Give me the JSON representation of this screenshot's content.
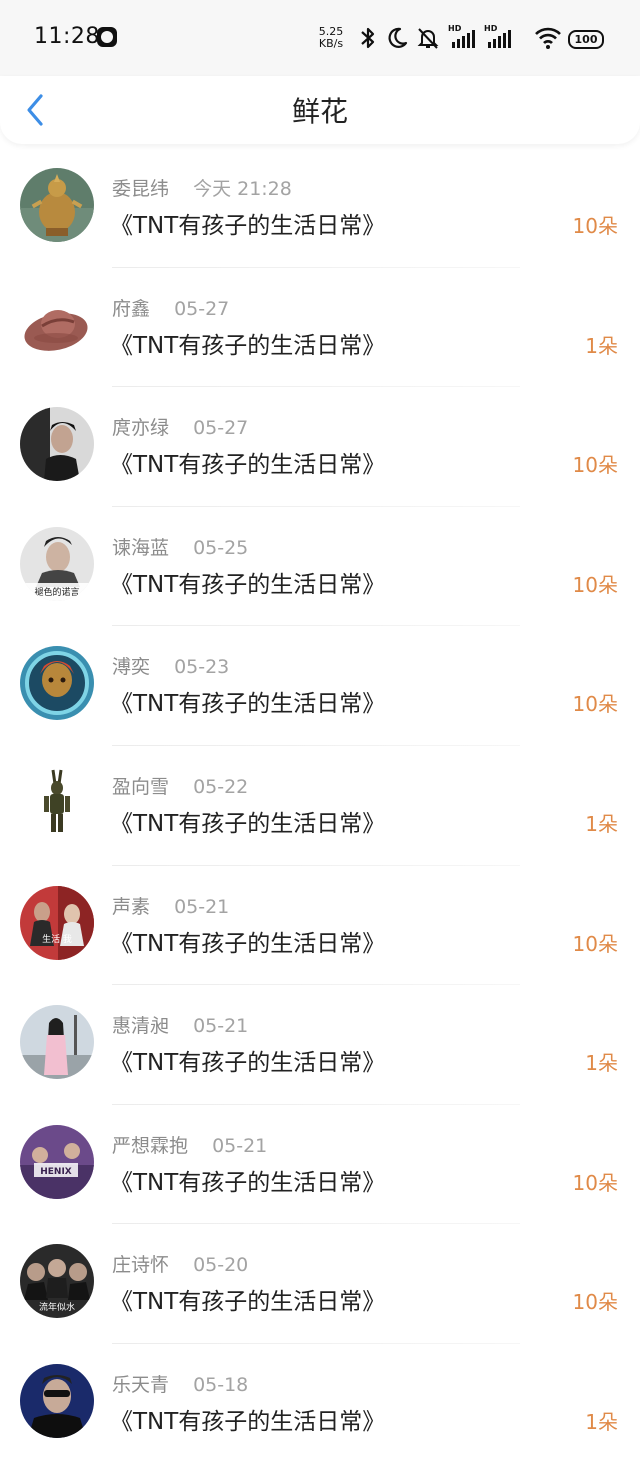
{
  "status": {
    "time": "11:28",
    "net_speed_value": "5.25",
    "net_speed_unit": "KB/s",
    "hd1": "HD",
    "hd2": "HD",
    "battery": "100",
    "icons": [
      "clock-icon",
      "bluetooth-icon",
      "moon-icon",
      "bell-off-icon",
      "signal-icon",
      "wifi-icon",
      "battery-icon"
    ]
  },
  "header": {
    "title": "鲜花",
    "back_icon": "chevron-left-icon",
    "accent": "#3d8ee6"
  },
  "colors": {
    "count": "#e08a48",
    "name": "#8c8c8c",
    "title": "#222222"
  },
  "rows": [
    {
      "name": "委昆纬",
      "date": "今天 21:28",
      "title": "《TNT有孩子的生活日常》",
      "count": "10朵",
      "avatar": "deity-statue"
    },
    {
      "name": "府鑫",
      "date": "05-27",
      "title": "《TNT有孩子的生活日常》",
      "count": "1朵",
      "avatar": "cowboy-hat"
    },
    {
      "name": "庹亦绿",
      "date": "05-27",
      "title": "《TNT有孩子的生活日常》",
      "count": "10朵",
      "avatar": "man-portrait"
    },
    {
      "name": "谏海蓝",
      "date": "05-25",
      "title": "《TNT有孩子的生活日常》",
      "count": "10朵",
      "avatar": "portrait-caption",
      "avatar_caption": "褪色的诺言"
    },
    {
      "name": "溥奕",
      "date": "05-23",
      "title": "《TNT有孩子的生活日常》",
      "count": "10朵",
      "avatar": "game-hero"
    },
    {
      "name": "盈向雪",
      "date": "05-22",
      "title": "《TNT有孩子的生活日常》",
      "count": "1朵",
      "avatar": "rabbit-figure"
    },
    {
      "name": "声素",
      "date": "05-21",
      "title": "《TNT有孩子的生活日常》",
      "count": "10朵",
      "avatar": "duo-red",
      "avatar_caption": "生活 我"
    },
    {
      "name": "惠清昶",
      "date": "05-21",
      "title": "《TNT有孩子的生活日常》",
      "count": "1朵",
      "avatar": "girl-street"
    },
    {
      "name": "严想霖抱",
      "date": "05-21",
      "title": "《TNT有孩子的生活日常》",
      "count": "10朵",
      "avatar": "purple-group",
      "avatar_caption": "HENIX"
    },
    {
      "name": "庄诗怀",
      "date": "05-20",
      "title": "《TNT有孩子的生活日常》",
      "count": "10朵",
      "avatar": "group-photo",
      "avatar_caption": "流年似水"
    },
    {
      "name": "乐天青",
      "date": "05-18",
      "title": "《TNT有孩子的生活日常》",
      "count": "1朵",
      "avatar": "man-sunglasses"
    }
  ]
}
